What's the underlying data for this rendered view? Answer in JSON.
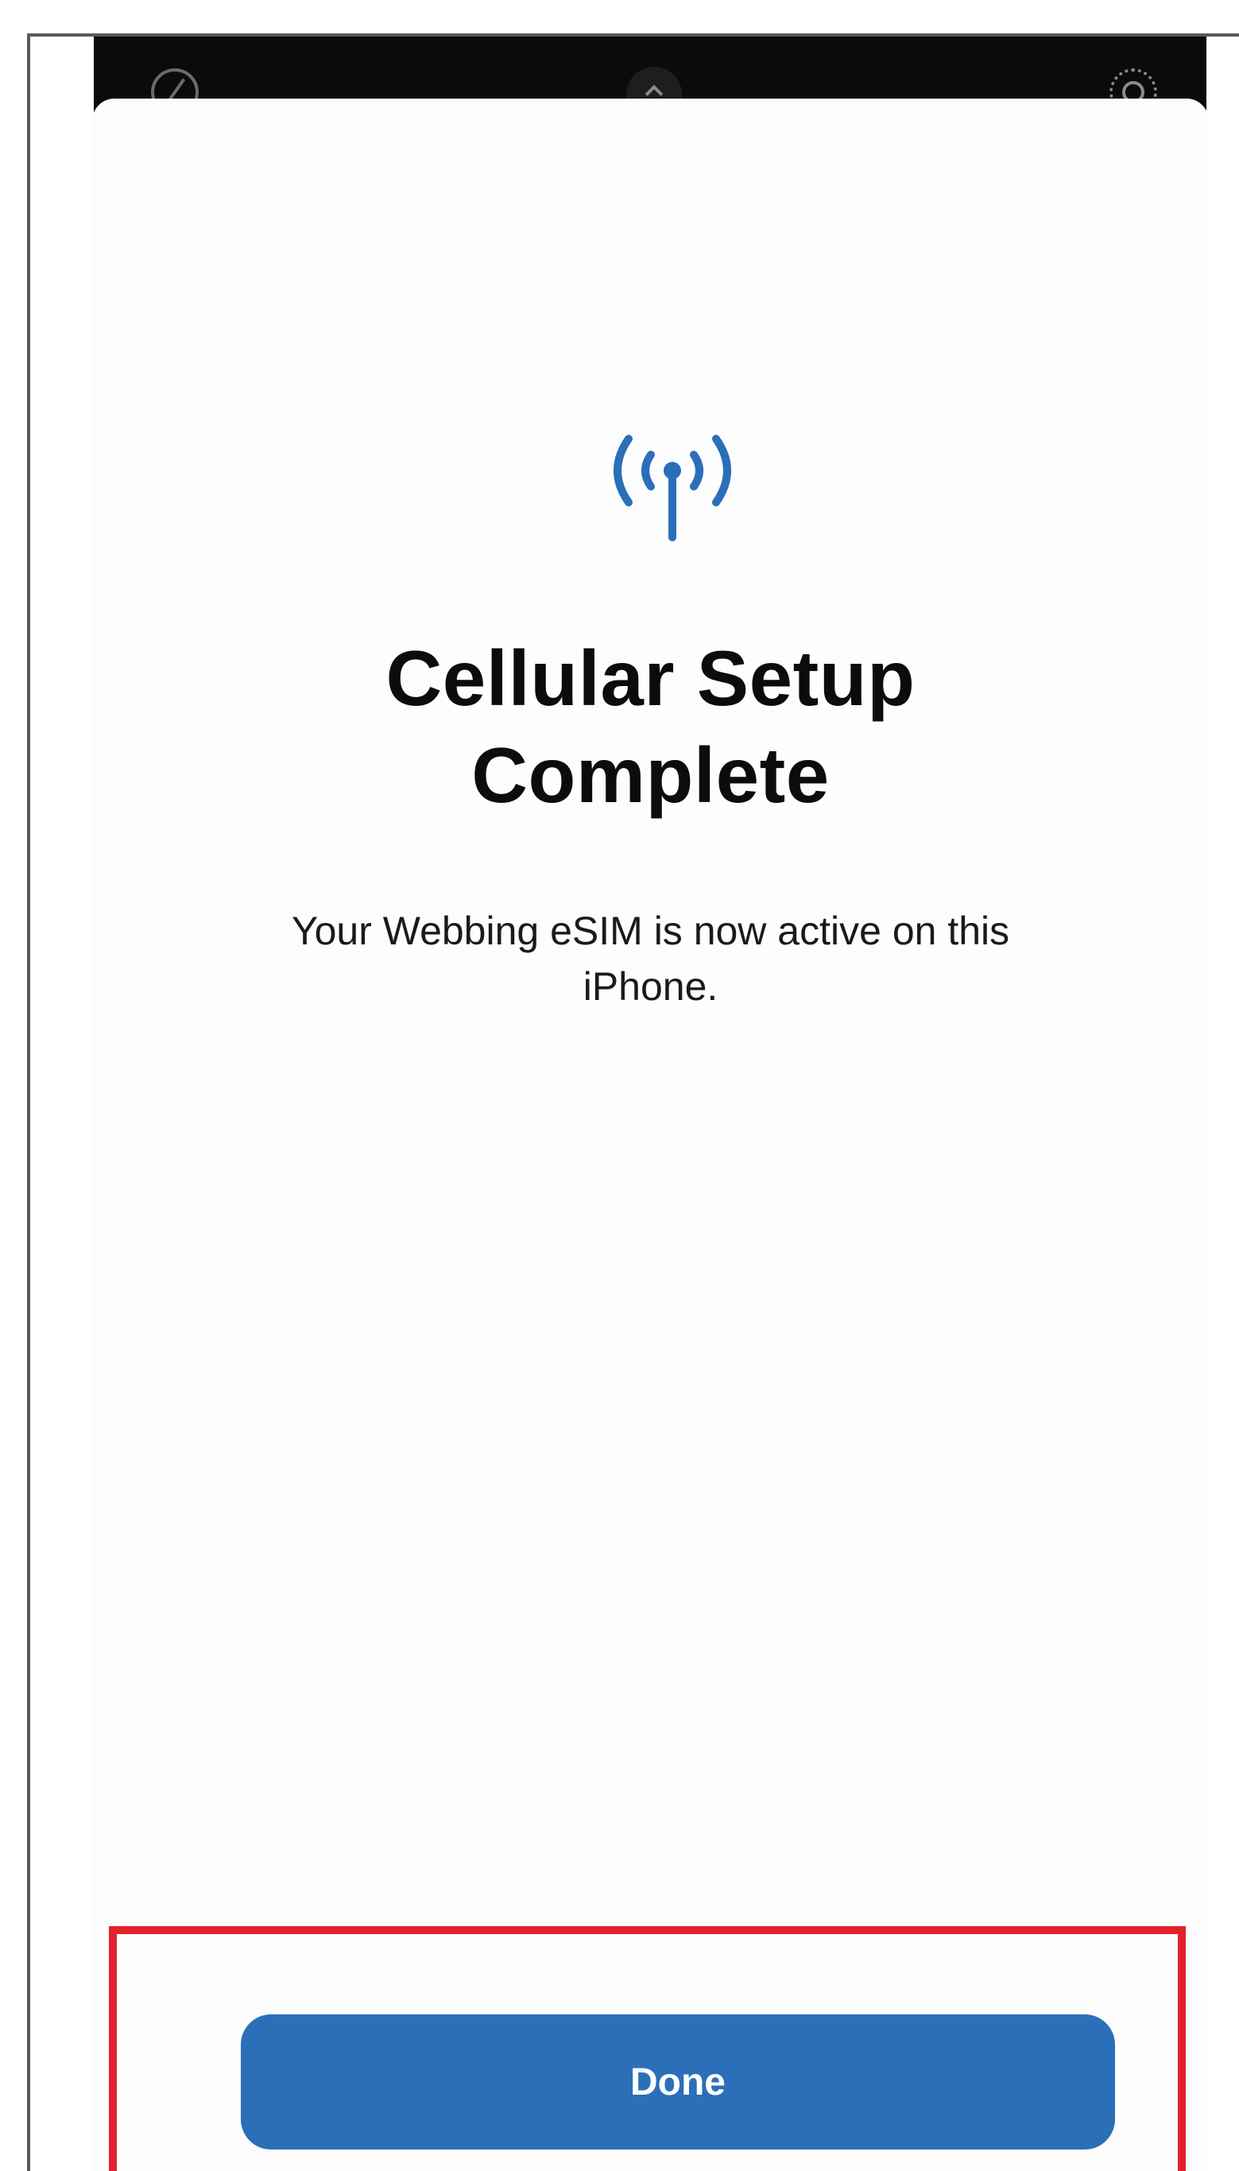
{
  "colors": {
    "accent": "#2b6fb9",
    "highlight": "#e3202c",
    "camera_bar": "#0b0b0b"
  },
  "status_bar": {
    "icons": [
      "compass-icon",
      "chevron-up-icon",
      "live-photo-icon"
    ]
  },
  "setup_sheet": {
    "icon": "cellular-antenna-icon",
    "title_line_1": "Cellular Setup",
    "title_line_2": "Complete",
    "message": "Your Webbing eSIM is now active on this iPhone."
  },
  "actions": {
    "done_label": "Done"
  }
}
